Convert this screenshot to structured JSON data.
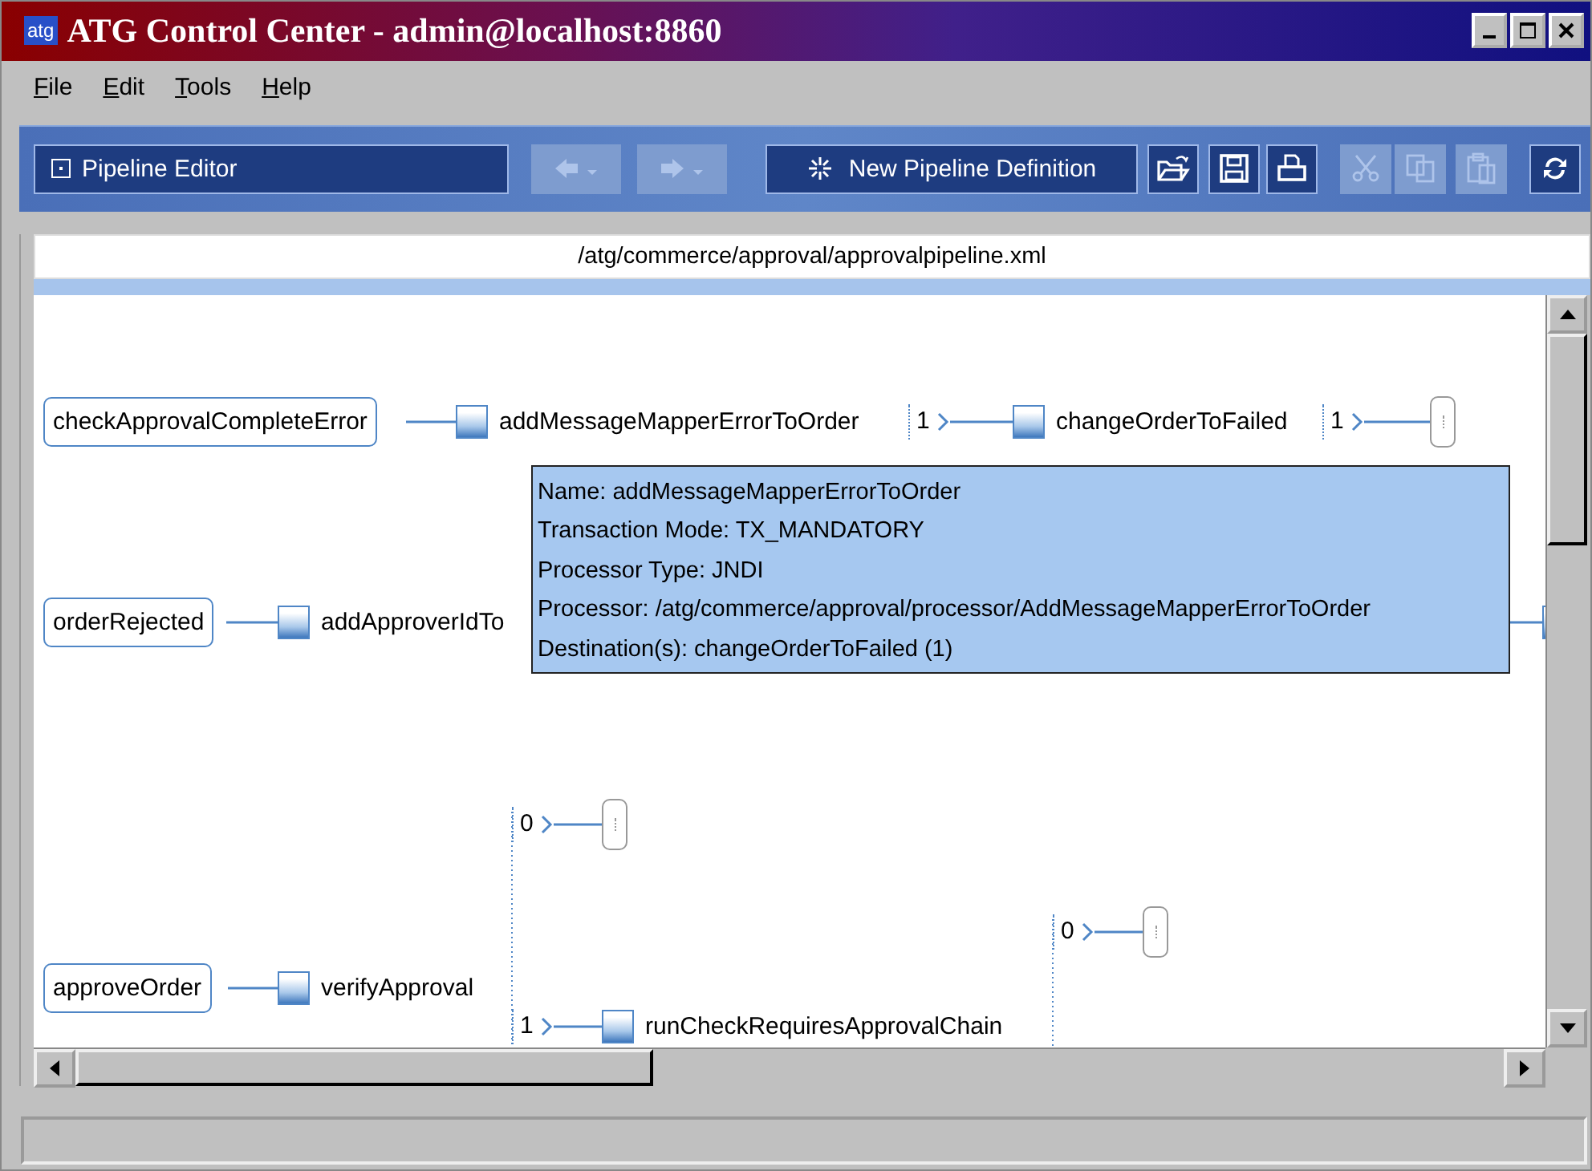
{
  "window": {
    "app_icon": "atg",
    "title": "ATG Control Center - admin@localhost:8860"
  },
  "menu": [
    {
      "label": "File"
    },
    {
      "label": "Edit"
    },
    {
      "label": "Tools"
    },
    {
      "label": "Help"
    }
  ],
  "toolbar": {
    "module_selector": {
      "label": "Pipeline Editor"
    },
    "buttons": [
      {
        "kind": "back",
        "disabled": true
      },
      {
        "kind": "forward",
        "disabled": true
      },
      {
        "kind": "new",
        "label": "New Pipeline Definition",
        "disabled": false
      },
      {
        "kind": "open",
        "disabled": false
      },
      {
        "kind": "save",
        "disabled": false
      },
      {
        "kind": "print",
        "disabled": false
      },
      {
        "kind": "cut",
        "disabled": true
      },
      {
        "kind": "copy",
        "disabled": true
      },
      {
        "kind": "paste",
        "disabled": true
      },
      {
        "kind": "refresh",
        "disabled": false
      }
    ]
  },
  "file_path": "/atg/commerce/approval/approvalpipeline.xml",
  "diagram": {
    "nodes": [
      {
        "kind": "chain",
        "label": "checkApprovalCompleteError"
      },
      {
        "kind": "processor",
        "label": "addMessageMapperErrorToOrder"
      },
      {
        "kind": "port",
        "label": "1"
      },
      {
        "kind": "processor",
        "label": "changeOrderToFailed"
      },
      {
        "kind": "port",
        "label": "1"
      },
      {
        "kind": "end"
      },
      {
        "kind": "chain",
        "label": "orderRejected"
      },
      {
        "kind": "processor",
        "label": "addApproverIdTo"
      },
      {
        "kind": "stub"
      },
      {
        "kind": "chain",
        "label": "approveOrder"
      },
      {
        "kind": "processor",
        "label": "verifyApproval"
      },
      {
        "kind": "port",
        "label": "0"
      },
      {
        "kind": "end"
      },
      {
        "kind": "port",
        "label": "1"
      },
      {
        "kind": "processor",
        "label": "runCheckRequiresApprovalChain"
      },
      {
        "kind": "port",
        "label": "0"
      },
      {
        "kind": "end"
      }
    ],
    "tooltip": {
      "lines": [
        "Name: addMessageMapperErrorToOrder",
        "Transaction Mode: TX_MANDATORY",
        "Processor Type: JNDI",
        "Processor: /atg/commerce/approval/processor/AddMessageMapperErrorToOrder",
        "Destination(s): changeOrderToFailed (1)"
      ]
    }
  }
}
